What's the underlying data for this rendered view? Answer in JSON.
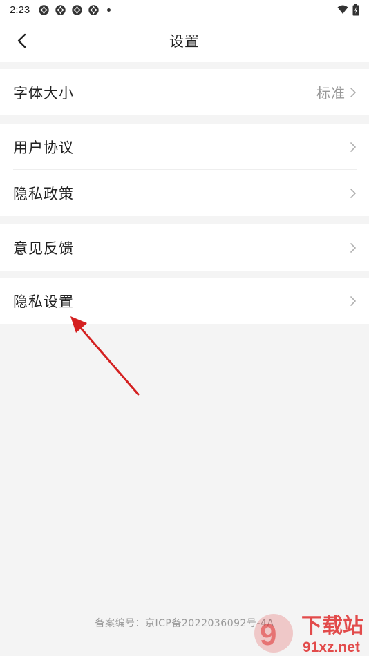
{
  "status_bar": {
    "time": "2:23",
    "notification_icons": [
      "app-notification-icon",
      "app-notification-icon",
      "app-notification-icon",
      "app-notification-icon"
    ]
  },
  "header": {
    "title": "设置",
    "back_icon": "chevron-left-icon"
  },
  "sections": [
    {
      "items": [
        {
          "label": "字体大小",
          "value": "标准"
        }
      ]
    },
    {
      "items": [
        {
          "label": "用户协议"
        },
        {
          "label": "隐私政策"
        }
      ]
    },
    {
      "items": [
        {
          "label": "意见反馈"
        }
      ]
    },
    {
      "items": [
        {
          "label": "隐私设置"
        }
      ]
    }
  ],
  "footer": {
    "record_text": "备案编号：京ICP备2022036092号-4A"
  },
  "watermark": {
    "brand_text": "下载站",
    "site_text": "91xz.net"
  },
  "colors": {
    "background": "#f4f4f4",
    "card": "#ffffff",
    "annotation_arrow": "#d42020",
    "watermark_red": "#e02e2e"
  }
}
